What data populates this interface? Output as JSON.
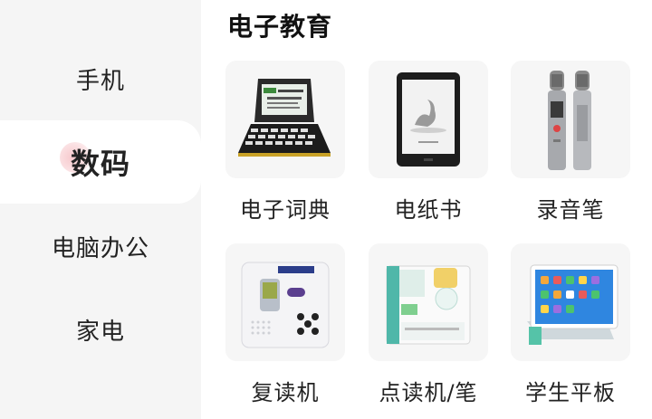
{
  "sidebar": {
    "items": [
      {
        "label": "手机",
        "active": false
      },
      {
        "label": "数码",
        "active": true
      },
      {
        "label": "电脑办公",
        "active": false
      },
      {
        "label": "家电",
        "active": false
      }
    ],
    "active_indicator_color": "#f7c9cd",
    "background": "#f5f5f5"
  },
  "section": {
    "title": "电子教育",
    "products": [
      {
        "label": "电子词典",
        "icon": "electronic-dictionary-image"
      },
      {
        "label": "电纸书",
        "icon": "ereader-image"
      },
      {
        "label": "录音笔",
        "icon": "voice-recorder-image"
      },
      {
        "label": "复读机",
        "icon": "repeater-image"
      },
      {
        "label": "点读机/笔",
        "icon": "reading-machine-image"
      },
      {
        "label": "学生平板",
        "icon": "student-tablet-image"
      }
    ]
  }
}
